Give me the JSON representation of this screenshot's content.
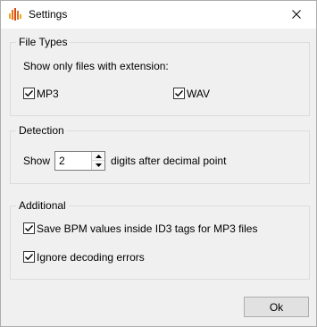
{
  "window": {
    "title": "Settings"
  },
  "icons": {
    "app": "bpm-waveform-icon",
    "close": "close-icon",
    "check": "check-icon"
  },
  "file_types": {
    "group_title": "File Types",
    "description": "Show only files with extension:",
    "mp3": {
      "label": "MP3",
      "checked": true
    },
    "wav": {
      "label": "WAV",
      "checked": true
    }
  },
  "detection": {
    "group_title": "Detection",
    "show_label": "Show",
    "digits_value": "2",
    "suffix_label": "digits after decimal point"
  },
  "additional": {
    "group_title": "Additional",
    "save_bpm": {
      "label": "Save BPM values inside ID3 tags for MP3 files",
      "checked": true
    },
    "ignore_errors": {
      "label": "Ignore decoding errors",
      "checked": true
    }
  },
  "buttons": {
    "ok": "Ok"
  },
  "colors": {
    "accent_orange": "#e8701a",
    "border": "#dcdcdc",
    "background": "#f0f0f0"
  }
}
